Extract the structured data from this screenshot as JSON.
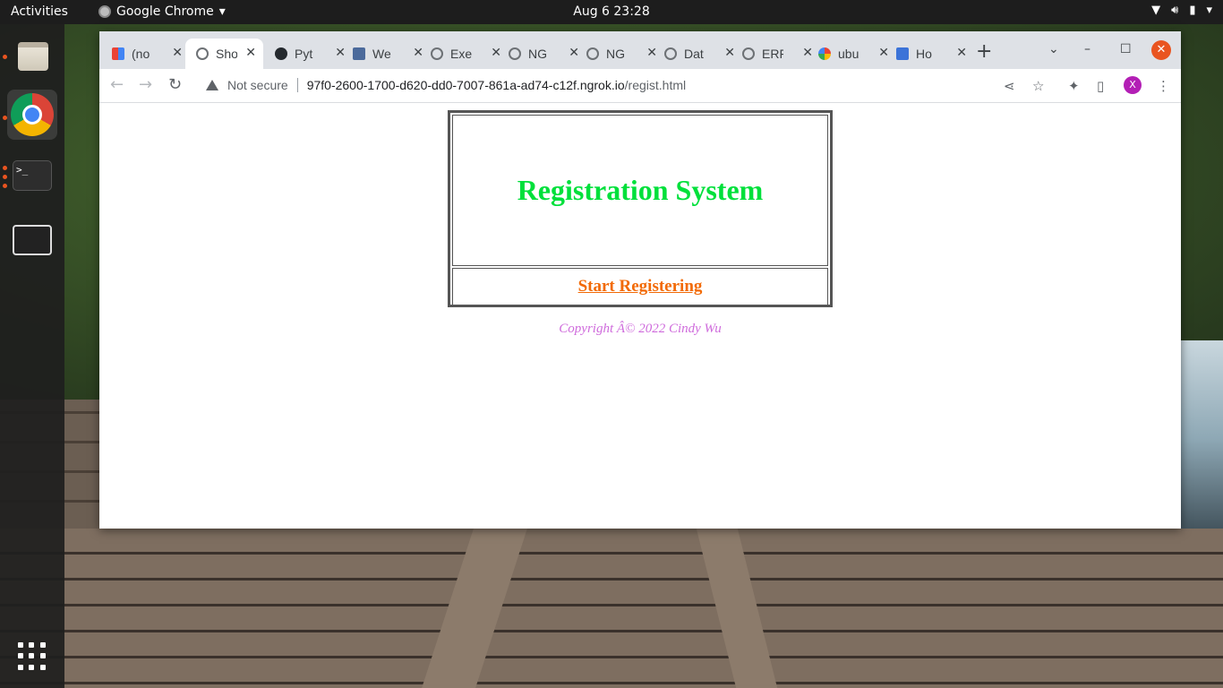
{
  "topbar": {
    "activities": "Activities",
    "app_name": "Google Chrome",
    "clock": "Aug 6  23:28"
  },
  "browser": {
    "tabs": [
      {
        "label": "(no",
        "icon": "gmail-icon"
      },
      {
        "label": "Sho",
        "icon": "globe-icon",
        "active": true
      },
      {
        "label": "Pyt",
        "icon": "github-icon"
      },
      {
        "label": "We",
        "icon": "site-icon"
      },
      {
        "label": "Exe",
        "icon": "globe-icon"
      },
      {
        "label": "NG",
        "icon": "globe-icon"
      },
      {
        "label": "NG",
        "icon": "globe-icon"
      },
      {
        "label": "Dat",
        "icon": "globe-icon"
      },
      {
        "label": "ERF",
        "icon": "globe-icon"
      },
      {
        "label": "ubu",
        "icon": "google-icon"
      },
      {
        "label": "Ho",
        "icon": "leetcode-icon"
      }
    ],
    "security_label": "Not secure",
    "url_host": "97f0-2600-1700-d620-dd0-7007-861a-ad74-c12f.ngrok.io",
    "url_path": "/regist.html",
    "profile_initial": "X"
  },
  "page": {
    "title": "Registration System",
    "start_link": "Start Registering",
    "copyright": "Copyright Â© 2022 Cindy Wu"
  },
  "colors": {
    "title": "#00e03b",
    "link": "#f26a06",
    "copyright": "#cf6bdc",
    "close_button": "#e95420",
    "profile": "#b31fb5"
  }
}
